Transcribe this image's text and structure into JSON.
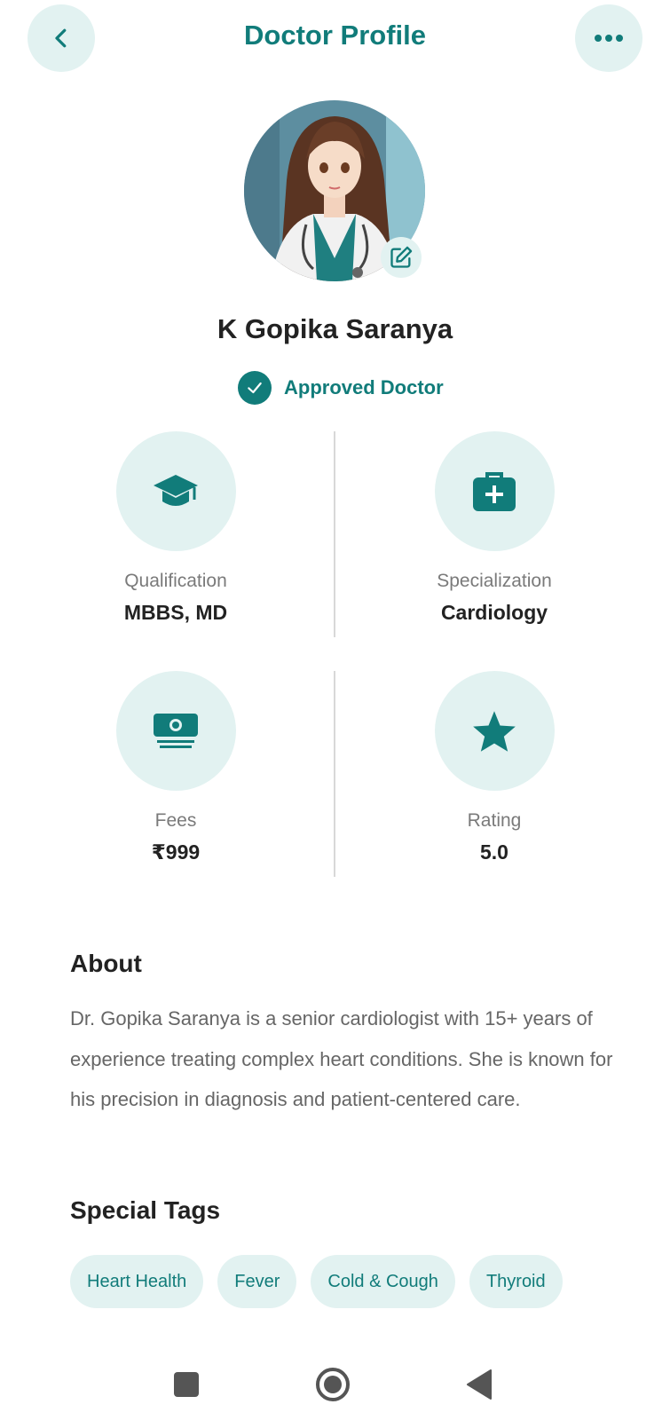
{
  "header": {
    "title": "Doctor Profile"
  },
  "doctor": {
    "name": "K Gopika Saranya",
    "status": "Approved Doctor"
  },
  "stats": [
    {
      "label": "Qualification",
      "value": "MBBS, MD",
      "icon": "graduation-cap-icon"
    },
    {
      "label": "Specialization",
      "value": "Cardiology",
      "icon": "medical-kit-icon"
    },
    {
      "label": "Fees",
      "value": "₹999",
      "icon": "cash-icon"
    },
    {
      "label": "Rating",
      "value": "5.0",
      "icon": "star-icon"
    }
  ],
  "about": {
    "heading": "About",
    "text": "Dr. Gopika Saranya is a senior cardiologist with 15+ years of experience treating complex heart conditions. She is known for his precision in diagnosis and patient-centered care."
  },
  "tags": {
    "heading": "Special Tags",
    "items": [
      "Heart Health",
      "Fever",
      "Cold & Cough",
      "Thyroid"
    ]
  },
  "colors": {
    "accent": "#117c7a",
    "accent_light": "#e2f2f1"
  }
}
